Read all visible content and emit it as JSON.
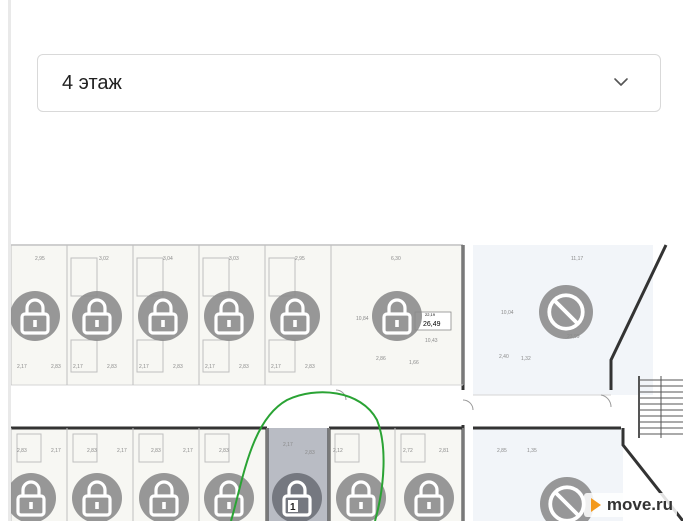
{
  "floor_select": {
    "value": "4 этаж",
    "expand_icon": "chevron-down-icon"
  },
  "plan": {
    "top_row_labels": [
      "2,95",
      "3,02",
      "3,04",
      "3,03",
      "2,95",
      "6,30",
      "11,17"
    ],
    "top_row_sublabels": [
      "2,17",
      "2,83",
      "2,17",
      "2,83",
      "2,17",
      "2,83",
      "2,17",
      "2,83",
      "2,17",
      "2,83"
    ],
    "top_big_labels": [
      "10,84",
      "2,86",
      "1,66",
      "10,43",
      "10,04",
      "2,40",
      "1,32",
      "23,99"
    ],
    "top_area_badge": "26,49",
    "top_area_badge_small": "22,19",
    "bottom_row_labels": [
      "2,83",
      "2,17",
      "2,83",
      "2,17",
      "2,83",
      "2,17",
      "2,83",
      "2,12",
      "2,72",
      "2,81",
      "2,85",
      "1,35"
    ],
    "highlighted_unit": {
      "labels": [
        "2,17",
        "2,83"
      ],
      "badge": "1",
      "small_label": "10,92"
    },
    "unit_states": {
      "top": [
        "locked",
        "locked",
        "locked",
        "locked",
        "locked",
        "locked",
        "unavailable"
      ],
      "bottom": [
        "locked",
        "locked",
        "locked",
        "locked",
        "selected",
        "locked",
        "locked",
        "unavailable"
      ]
    },
    "colors": {
      "walls": "#333333",
      "thin_walls": "#bfbfbf",
      "unit_fill": "#f7f7f3",
      "badge": "#8a8a8a",
      "selected_fill": "#b9bcc4",
      "annotation": "#2aa334"
    }
  },
  "watermark": {
    "text": "move.ru",
    "accent": "#f39a1e"
  }
}
